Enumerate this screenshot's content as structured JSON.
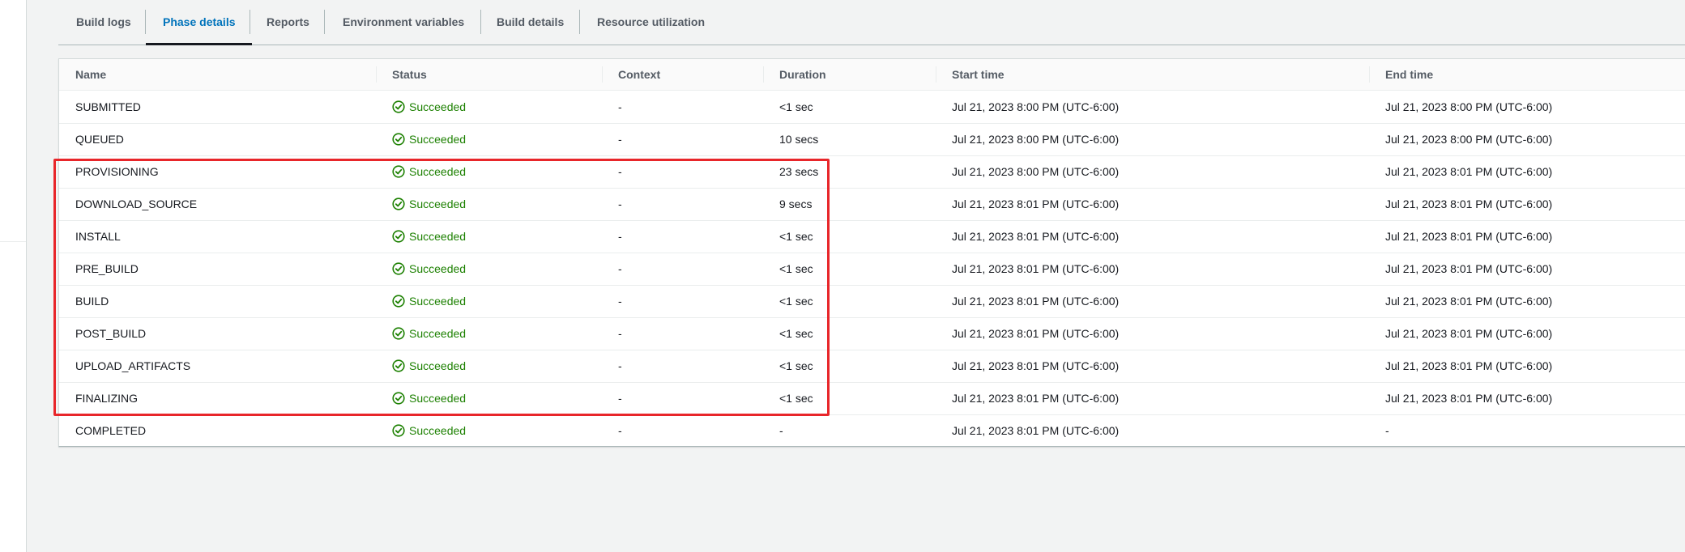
{
  "tabs": [
    {
      "label": "Build logs",
      "active": false
    },
    {
      "label": "Phase details",
      "active": true
    },
    {
      "label": "Reports",
      "active": false
    },
    {
      "label": "Environment variables",
      "active": false
    },
    {
      "label": "Build details",
      "active": false
    },
    {
      "label": "Resource utilization",
      "active": false
    }
  ],
  "table": {
    "columns": [
      "Name",
      "Status",
      "Context",
      "Duration",
      "Start time",
      "End time"
    ],
    "rows": [
      {
        "name": "SUBMITTED",
        "status": "Succeeded",
        "context": "-",
        "duration": "<1 sec",
        "start": "Jul 21, 2023 8:00 PM (UTC-6:00)",
        "end": "Jul 21, 2023 8:00 PM (UTC-6:00)"
      },
      {
        "name": "QUEUED",
        "status": "Succeeded",
        "context": "-",
        "duration": "10 secs",
        "start": "Jul 21, 2023 8:00 PM (UTC-6:00)",
        "end": "Jul 21, 2023 8:00 PM (UTC-6:00)"
      },
      {
        "name": "PROVISIONING",
        "status": "Succeeded",
        "context": "-",
        "duration": "23 secs",
        "start": "Jul 21, 2023 8:00 PM (UTC-6:00)",
        "end": "Jul 21, 2023 8:01 PM (UTC-6:00)"
      },
      {
        "name": "DOWNLOAD_SOURCE",
        "status": "Succeeded",
        "context": "-",
        "duration": "9 secs",
        "start": "Jul 21, 2023 8:01 PM (UTC-6:00)",
        "end": "Jul 21, 2023 8:01 PM (UTC-6:00)"
      },
      {
        "name": "INSTALL",
        "status": "Succeeded",
        "context": "-",
        "duration": "<1 sec",
        "start": "Jul 21, 2023 8:01 PM (UTC-6:00)",
        "end": "Jul 21, 2023 8:01 PM (UTC-6:00)"
      },
      {
        "name": "PRE_BUILD",
        "status": "Succeeded",
        "context": "-",
        "duration": "<1 sec",
        "start": "Jul 21, 2023 8:01 PM (UTC-6:00)",
        "end": "Jul 21, 2023 8:01 PM (UTC-6:00)"
      },
      {
        "name": "BUILD",
        "status": "Succeeded",
        "context": "-",
        "duration": "<1 sec",
        "start": "Jul 21, 2023 8:01 PM (UTC-6:00)",
        "end": "Jul 21, 2023 8:01 PM (UTC-6:00)"
      },
      {
        "name": "POST_BUILD",
        "status": "Succeeded",
        "context": "-",
        "duration": "<1 sec",
        "start": "Jul 21, 2023 8:01 PM (UTC-6:00)",
        "end": "Jul 21, 2023 8:01 PM (UTC-6:00)"
      },
      {
        "name": "UPLOAD_ARTIFACTS",
        "status": "Succeeded",
        "context": "-",
        "duration": "<1 sec",
        "start": "Jul 21, 2023 8:01 PM (UTC-6:00)",
        "end": "Jul 21, 2023 8:01 PM (UTC-6:00)"
      },
      {
        "name": "FINALIZING",
        "status": "Succeeded",
        "context": "-",
        "duration": "<1 sec",
        "start": "Jul 21, 2023 8:01 PM (UTC-6:00)",
        "end": "Jul 21, 2023 8:01 PM (UTC-6:00)"
      },
      {
        "name": "COMPLETED",
        "status": "Succeeded",
        "context": "-",
        "duration": "-",
        "start": "Jul 21, 2023 8:01 PM (UTC-6:00)",
        "end": "-"
      }
    ]
  },
  "colors": {
    "accent": "#0073bb",
    "success": "#1d8102",
    "highlight": "#e8262a"
  },
  "icons": {
    "status": "status-success-icon"
  }
}
